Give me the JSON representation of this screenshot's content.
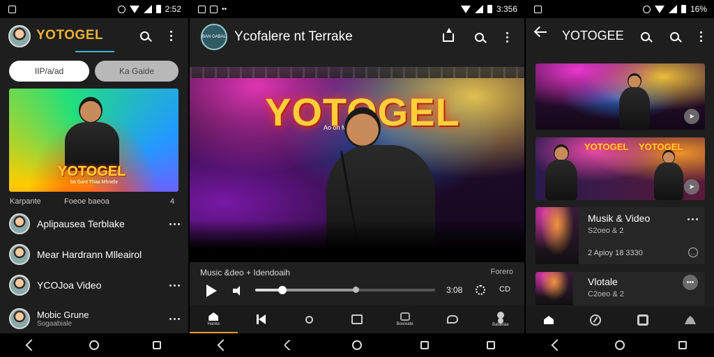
{
  "screen1": {
    "status": {
      "time": "2:52"
    },
    "header": {
      "logo": "YOTOGEL"
    },
    "chips": {
      "left": "IIP/a/ad",
      "right": "Ka Gaide"
    },
    "hero": {
      "title": "YOTOGEL",
      "subtitle": "ba Gant Thaa Mhnebr"
    },
    "row": {
      "left_label": "Karpante",
      "mid_label": "Foeoe baeoa",
      "right_label": "4"
    },
    "list": [
      {
        "title": "Aplipausea Terblake",
        "sub": ""
      },
      {
        "title": "Mear Hardrann Mlleairol",
        "sub": ""
      },
      {
        "title": "YCOJoa Video",
        "sub": ""
      },
      {
        "title": "Mobic Grune",
        "sub": "Sogaabiale"
      }
    ]
  },
  "screen2": {
    "status": {
      "time": "3:356"
    },
    "header": {
      "logo_text": "BAN GABAL",
      "title": "Ycofalere nt Terrake"
    },
    "video": {
      "stage_title": "YOTOGEL",
      "stage_sub": "Ao oh Mu Stllea Fa"
    },
    "meta": {
      "title": "Music &deo + Idendoaih",
      "right": "Forero"
    },
    "player": {
      "time": "3:08",
      "cc": "CD",
      "progress": 0.15,
      "buffered": 0.56
    },
    "tabs": [
      {
        "label": "Hanke",
        "icon": "home-icon"
      },
      {
        "label": "",
        "icon": "skip-back-icon"
      },
      {
        "label": "",
        "icon": "search-icon"
      },
      {
        "label": "",
        "icon": "grid-icon"
      },
      {
        "label": "Bosreate",
        "icon": "library-icon"
      },
      {
        "label": "",
        "icon": "chat-icon"
      },
      {
        "label": "Balaeiaa",
        "icon": "account-icon"
      }
    ]
  },
  "screen3": {
    "status": {
      "time": "16%"
    },
    "header": {
      "title": "YOTOGEE"
    },
    "thumb2": {
      "title_a": "YOTOGEL",
      "title_b": "YOTOGEL"
    },
    "card1": {
      "title": "Musik & Video",
      "line2": "S2oeo & 2",
      "line3": "2 Apioy 18 3330"
    },
    "card2": {
      "title": "Vlotale",
      "line2": "C2oeo & 2"
    }
  },
  "colors": {
    "accent_gold": "#f2b233",
    "accent_blue": "#3fb3d9",
    "tab_active": "#f0a020"
  }
}
